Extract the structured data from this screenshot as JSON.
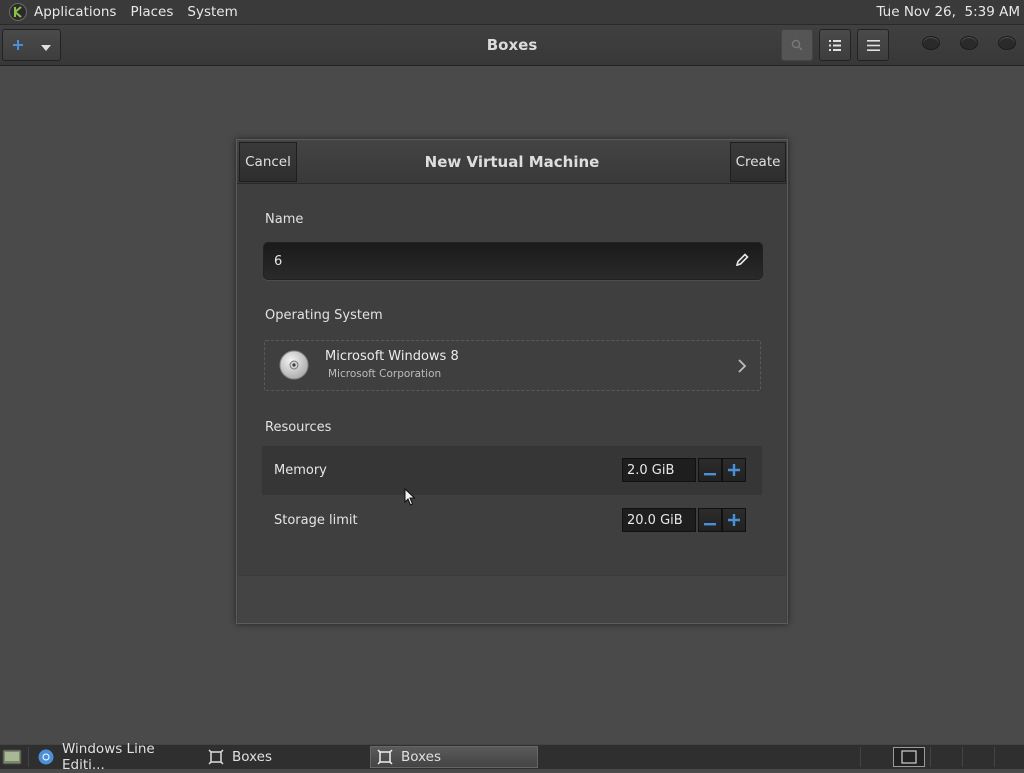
{
  "top_panel": {
    "menu_icon": "mate-logo-icon",
    "menus": [
      "Applications",
      "Places",
      "System"
    ],
    "clock": "Tue Nov 26,  5:39 AM"
  },
  "header_bar": {
    "title": "Boxes",
    "new_button_icon": "plus-icon",
    "new_dropdown_icon": "chevron-down-icon",
    "search_icon": "search-icon",
    "list_view_icon": "list-view-icon",
    "menu_icon": "hamburger-menu-icon"
  },
  "dialog": {
    "title": "New Virtual Machine",
    "cancel_label": "Cancel",
    "create_label": "Create",
    "name_label": "Name",
    "name_value": "6",
    "os_label": "Operating System",
    "os_name": "Microsoft Windows 8",
    "os_vendor": "Microsoft Corporation",
    "resources_label": "Resources",
    "memory_label": "Memory",
    "memory_value": "2.0 GiB",
    "storage_label": "Storage limit",
    "storage_value": "20.0 GiB"
  },
  "taskbar": {
    "items": [
      {
        "label": "Windows Line Editi...",
        "icon": "chromium-icon",
        "active": false
      },
      {
        "label": "Boxes",
        "icon": "boxes-icon",
        "active": false
      },
      {
        "label": "Boxes",
        "icon": "boxes-icon",
        "active": true
      }
    ]
  },
  "colors": {
    "accent_blue": "#4a90d9",
    "background": "#4a4a4a",
    "panel": "#3a3a3a"
  }
}
